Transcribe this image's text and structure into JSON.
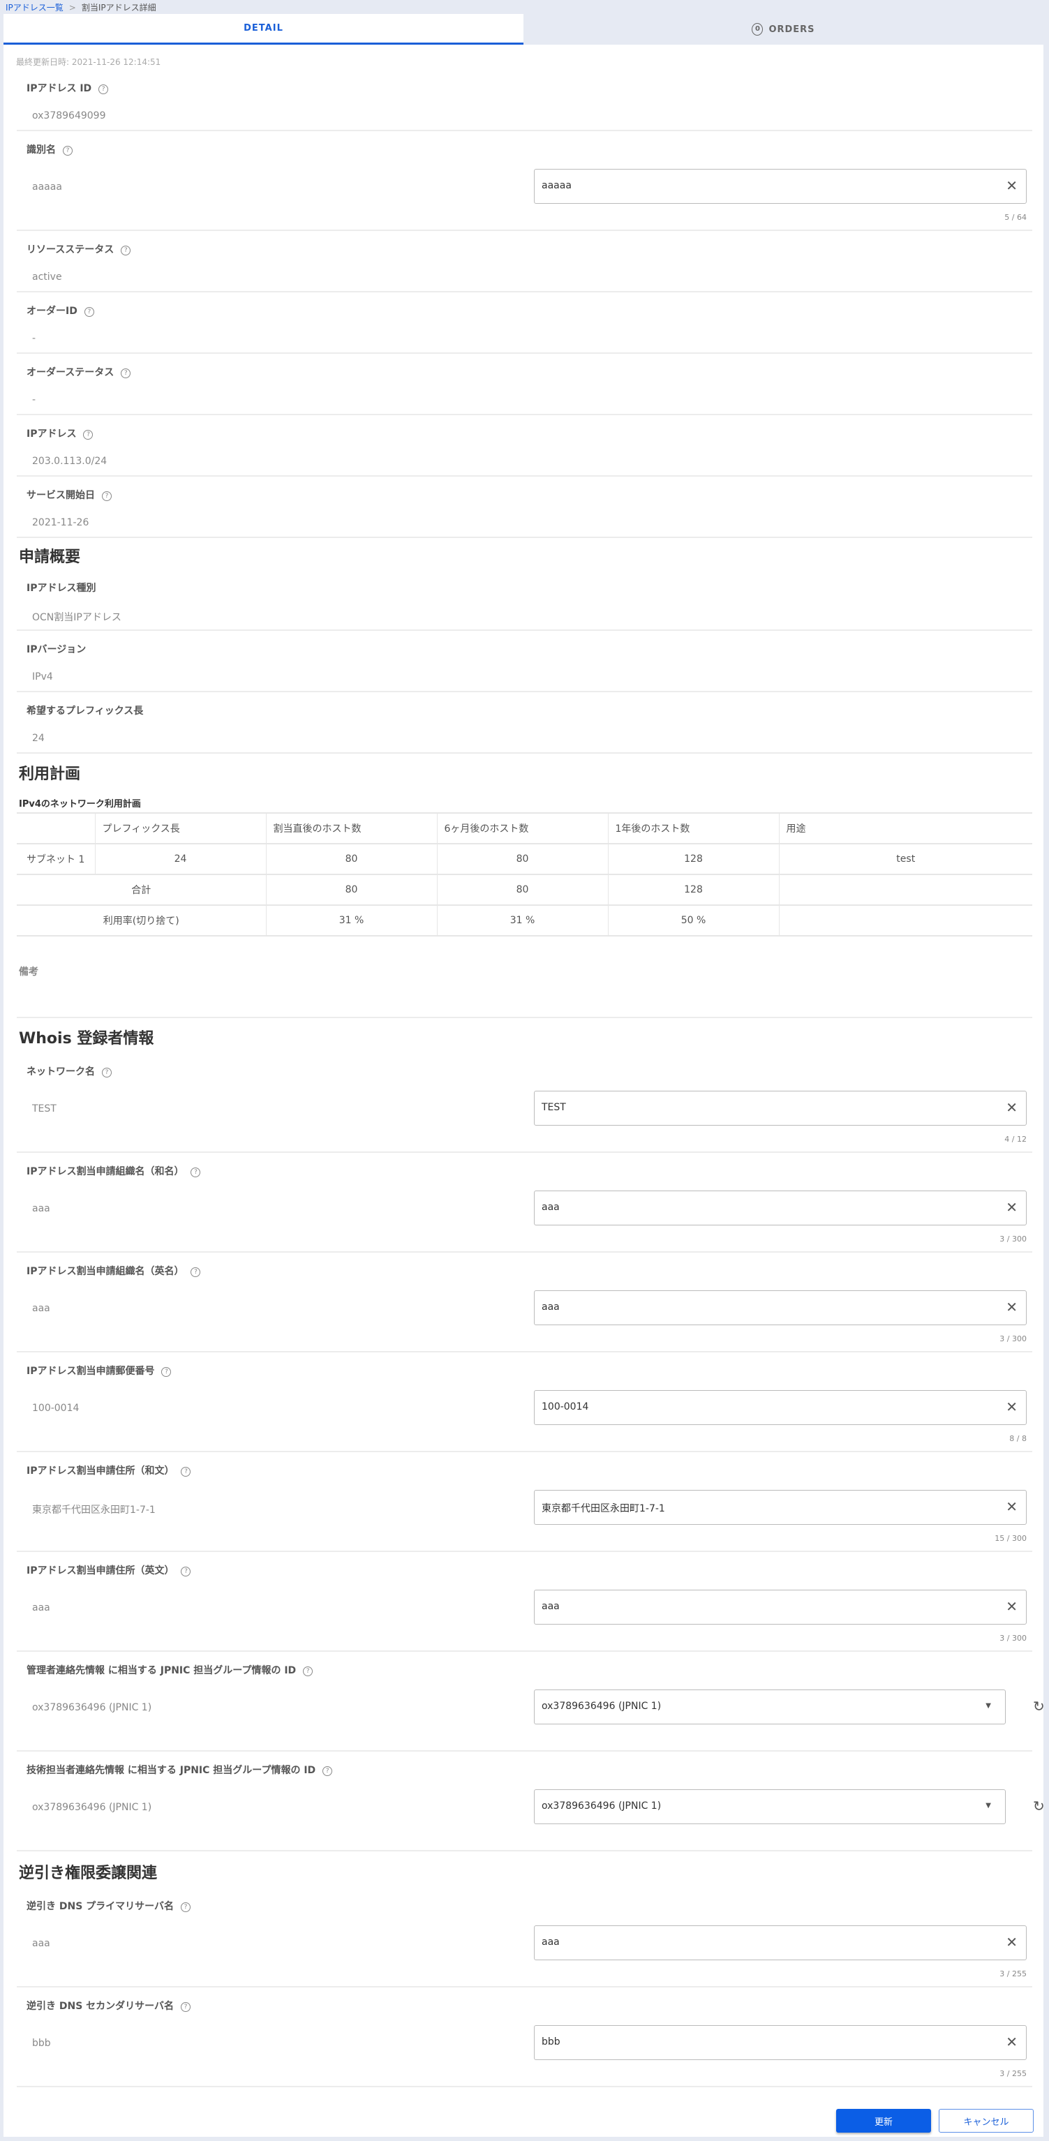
{
  "breadcrumb": {
    "parent": "IPアドレス一覧",
    "sep": ">",
    "current": "割当IPアドレス詳細"
  },
  "tabs": {
    "detail": "DETAIL",
    "orders": "ORDERS",
    "orders_count": "0"
  },
  "last_updated": "最終更新日時: 2021-11-26 12:14:51",
  "help_icon": "?",
  "basic": [
    {
      "label": "IPアドレス ID",
      "value": "ox3789649099"
    },
    {
      "label": "識別名",
      "value": "aaaaa",
      "input": "aaaaa",
      "counter": "5 / 64"
    },
    {
      "label": "リソースステータス",
      "value": "active"
    },
    {
      "label": "オーダーID",
      "value": "-"
    },
    {
      "label": "オーダーステータス",
      "value": "-"
    },
    {
      "label": "IPアドレス",
      "value": "203.0.113.0/24"
    },
    {
      "label": "サービス開始日",
      "value": "2021-11-26"
    }
  ],
  "application": {
    "title": "申請概要",
    "rows": [
      {
        "label": "IPアドレス種別",
        "value": "OCN割当IPアドレス"
      },
      {
        "label": "IPバージョン",
        "value": "IPv4"
      },
      {
        "label": "希望するプレフィックス長",
        "value": "24"
      }
    ]
  },
  "plan": {
    "title": "利用計画",
    "subtitle": "IPv4のネットワーク利用計画",
    "headers": [
      "",
      "プレフィックス長",
      "割当直後のホスト数",
      "6ヶ月後のホスト数",
      "1年後のホスト数",
      "用途"
    ],
    "subnet": [
      "サブネット 1",
      "24",
      "80",
      "80",
      "128",
      "test"
    ],
    "total": [
      "合計",
      "80",
      "80",
      "128",
      ""
    ],
    "rate": [
      "利用率(切り捨て)",
      "31 %",
      "31 %",
      "50 %",
      ""
    ],
    "note_label": "備考"
  },
  "whois": {
    "title": "Whois 登録者情報",
    "rows": [
      {
        "label": "ネットワーク名",
        "value": "TEST",
        "input": "TEST",
        "counter": "4 / 12"
      },
      {
        "label": "IPアドレス割当申請組織名（和名）",
        "value": "aaa",
        "input": "aaa",
        "counter": "3 / 300"
      },
      {
        "label": "IPアドレス割当申請組織名（英名）",
        "value": "aaa",
        "input": "aaa",
        "counter": "3 / 300"
      },
      {
        "label": "IPアドレス割当申請郵便番号",
        "value": "100-0014",
        "input": "100-0014",
        "counter": "8 / 8"
      },
      {
        "label": "IPアドレス割当申請住所（和文）",
        "value": "東京都千代田区永田町1-7-1",
        "input": "東京都千代田区永田町1-7-1",
        "counter": "15 / 300"
      },
      {
        "label": "IPアドレス割当申請住所（英文）",
        "value": "aaa",
        "input": "aaa",
        "counter": "3 / 300"
      },
      {
        "label": "管理者連絡先情報 に相当する JPNIC 担当グループ情報の ID",
        "value": "ox3789636496 (JPNIC 1)",
        "select": "ox3789636496 (JPNIC 1)"
      },
      {
        "label": "技術担当者連絡先情報 に相当する JPNIC 担当グループ情報の ID",
        "value": "ox3789636496 (JPNIC 1)",
        "select": "ox3789636496 (JPNIC 1)"
      }
    ]
  },
  "reverse": {
    "title": "逆引き権限委譲関連",
    "rows": [
      {
        "label": "逆引き DNS プライマリサーバ名",
        "value": "aaa",
        "input": "aaa",
        "counter": "3 / 255"
      },
      {
        "label": "逆引き DNS セカンダリサーバ名",
        "value": "bbb",
        "input": "bbb",
        "counter": "3 / 255"
      }
    ]
  },
  "actions": {
    "update": "更新",
    "cancel": "キャンセル"
  }
}
